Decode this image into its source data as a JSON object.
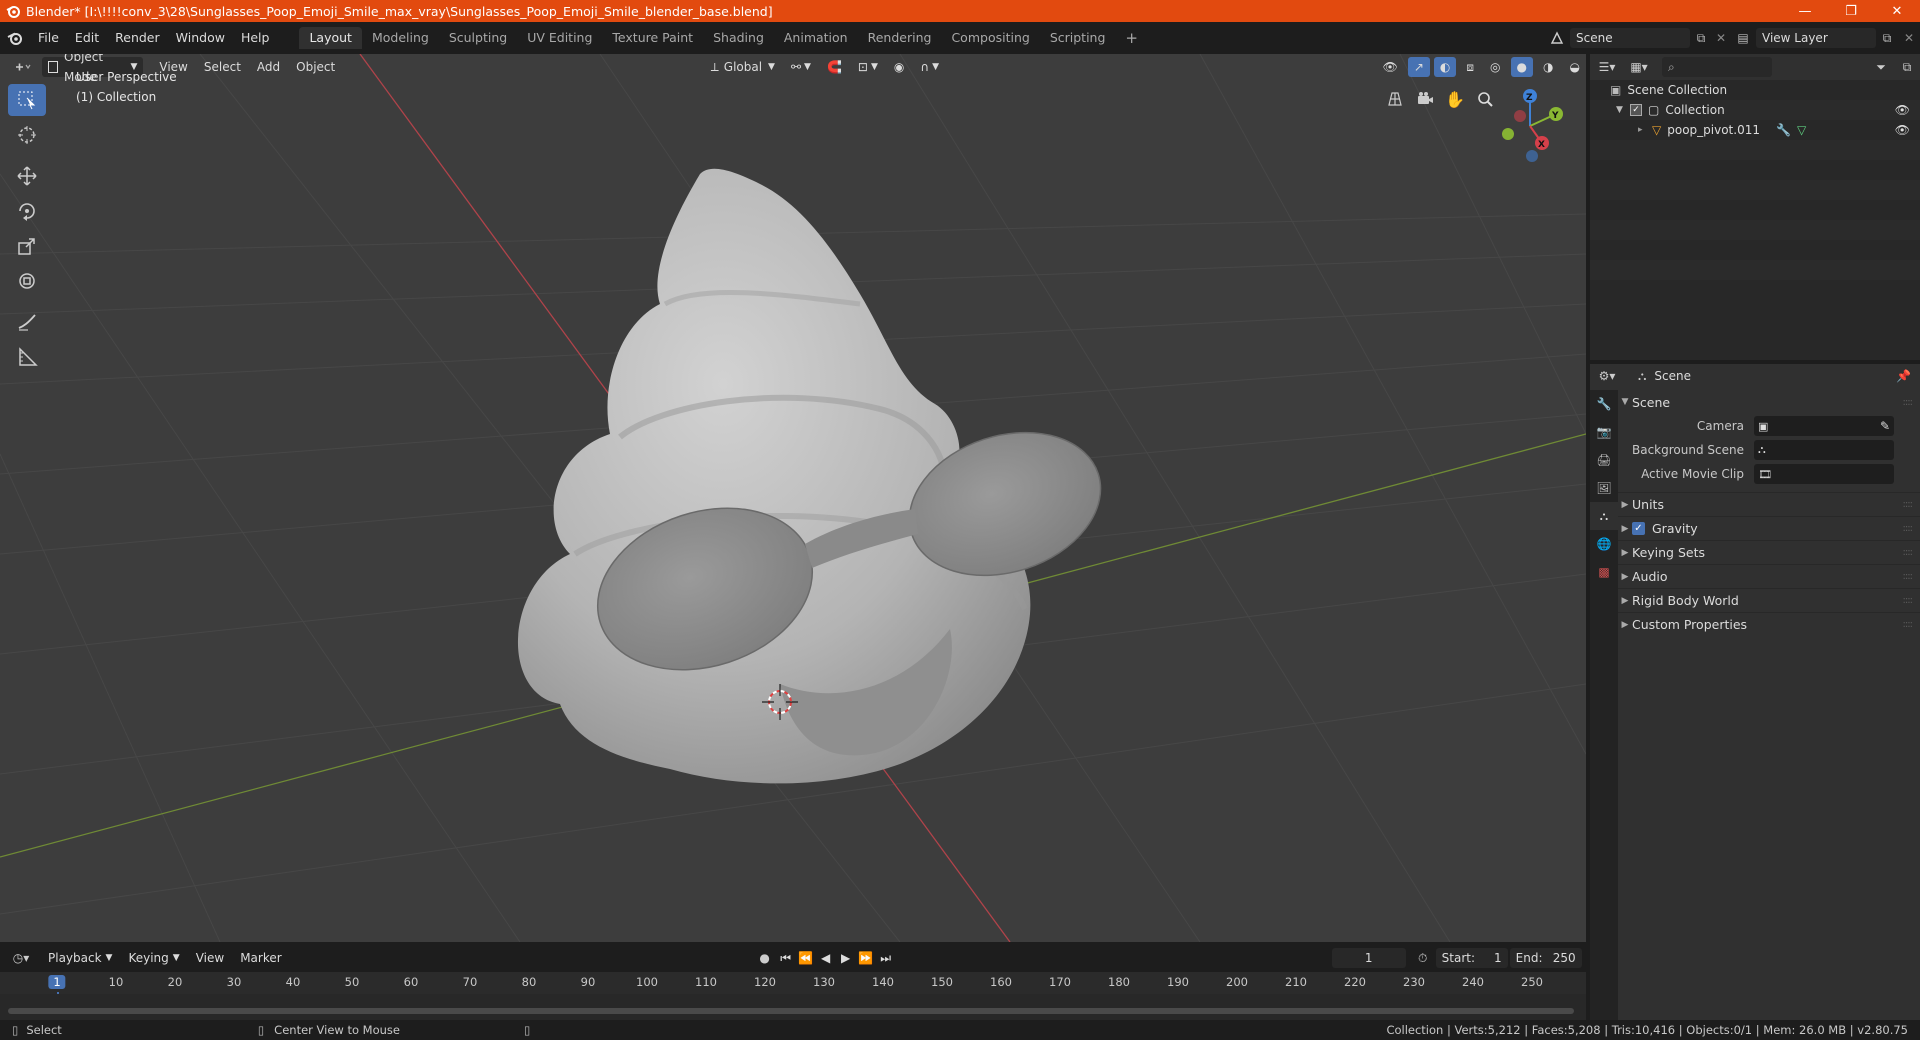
{
  "window": {
    "title": "Blender* [I:\\!!!!conv_3\\28\\Sunglasses_Poop_Emoji_Smile_max_vray\\Sunglasses_Poop_Emoji_Smile_blender_base.blend]",
    "minimize": "—",
    "restore": "❐",
    "close": "✕"
  },
  "menu": {
    "items": [
      "File",
      "Edit",
      "Render",
      "Window",
      "Help"
    ],
    "workspaces": [
      "Layout",
      "Modeling",
      "Sculpting",
      "UV Editing",
      "Texture Paint",
      "Shading",
      "Animation",
      "Rendering",
      "Compositing",
      "Scripting"
    ],
    "add_tab": "+",
    "scene_name": "Scene",
    "view_layer": "View Layer"
  },
  "viewport": {
    "mode": "Object Mode",
    "menus": [
      "View",
      "Select",
      "Add",
      "Object"
    ],
    "transform_orientation": "Global",
    "overlay_title": "User Perspective",
    "overlay_collection": "(1) Collection",
    "axis_labels": {
      "x": "X",
      "y": "Y",
      "z": "Z"
    }
  },
  "outliner": {
    "search_placeholder": "",
    "scene_collection": "Scene Collection",
    "collection": "Collection",
    "object": "poop_pivot.011"
  },
  "properties": {
    "context": "Scene",
    "panel": "Scene",
    "camera_label": "Camera",
    "bg_scene_label": "Background Scene",
    "movie_clip_label": "Active Movie Clip",
    "subpanels": [
      "Units",
      "Gravity",
      "Keying Sets",
      "Audio",
      "Rigid Body World",
      "Custom Properties"
    ],
    "gravity_checked": true
  },
  "timeline": {
    "menus": [
      "Playback",
      "Keying",
      "View",
      "Marker"
    ],
    "current_frame": "1",
    "start_label": "Start:",
    "start": "1",
    "end_label": "End:",
    "end": "250",
    "ticks": [
      "1",
      "10",
      "20",
      "30",
      "40",
      "50",
      "60",
      "70",
      "80",
      "90",
      "100",
      "110",
      "120",
      "130",
      "140",
      "150",
      "160",
      "170",
      "180",
      "190",
      "200",
      "210",
      "220",
      "230",
      "240",
      "250"
    ]
  },
  "status": {
    "select": "Select",
    "center_view": "Center View to Mouse",
    "stats": "Collection | Verts:5,212 | Faces:5,208 | Tris:10,416 | Objects:0/1 | Mem: 26.0 MB | v2.80.75"
  },
  "colors": {
    "titlebar": "#e24a0f",
    "active_tool": "#4772b3",
    "axis_x": "#d6404a",
    "axis_y": "#8ab833",
    "axis_z": "#3f82d8"
  }
}
